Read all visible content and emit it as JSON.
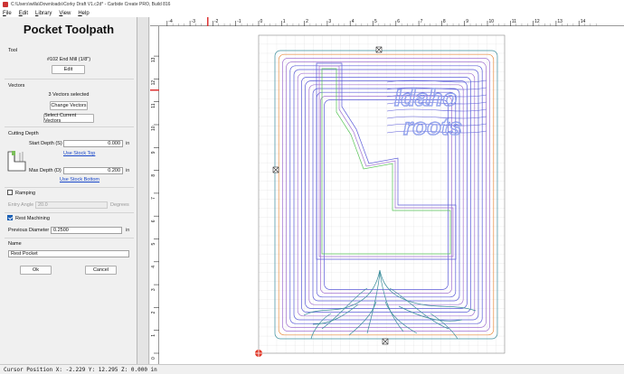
{
  "window": {
    "title": "C:\\Users\\willa\\Downloads\\Corky Draft V1.c2d* - Carbide Create PRO, Build 816"
  },
  "menu": [
    "File",
    "Edit",
    "Library",
    "View",
    "Help"
  ],
  "panel": {
    "title": "Pocket Toolpath",
    "tool": {
      "section": "Tool",
      "name": "#102 End Mill (1/8\")",
      "edit_label": "Edit"
    },
    "vectors": {
      "section": "Vectors",
      "selected_text": "3 Vectors selected",
      "change_label": "Change Vectors",
      "select_current_label": "Select Current Vectors"
    },
    "cutting_depth": {
      "section": "Cutting Depth",
      "start_label": "Start Depth (S)",
      "start_value": "0.000",
      "start_unit": "in",
      "use_stock_top": "Use Stock Top",
      "max_label": "Max Depth (D)",
      "max_value": "0.200",
      "max_unit": "in",
      "use_stock_bottom": "Use Stock Bottom"
    },
    "ramping": {
      "label": "Ramping",
      "checked": false,
      "entry_angle_label": "Entry Angle",
      "entry_angle_value": "20.0",
      "entry_angle_unit": "Degrees"
    },
    "rest_machining": {
      "label": "Rest Machining",
      "checked": true,
      "previous_diameter_label": "Previous Diameter",
      "previous_diameter_value": "0.2500",
      "previous_diameter_unit": "in"
    },
    "name": {
      "section": "Name",
      "value": "Rest Pocket"
    },
    "ok_label": "Ok",
    "cancel_label": "Cancel"
  },
  "canvas": {
    "ruler_x": [
      "-4",
      "-3",
      "-2",
      "-1",
      "0",
      "1",
      "2",
      "3",
      "4",
      "5",
      "6",
      "7",
      "8",
      "9",
      "10",
      "11",
      "12",
      "13",
      "14"
    ],
    "ruler_y": [
      "13",
      "12",
      "11",
      "10",
      "9",
      "8",
      "7",
      "6",
      "5",
      "4",
      "3",
      "2",
      "1",
      "0"
    ],
    "design_text_line1": "Idaho",
    "design_text_line2": "roots",
    "colors": {
      "toolpath_blue": "#5a5ad8",
      "toolpath_purple": "#a070d0",
      "boundary_orange": "#e88a3c",
      "boundary_green": "#56c456",
      "roots_teal": "#3a8c9a"
    }
  },
  "status": {
    "text": "Cursor Position X: -2.229 Y: 12.295 Z: 0.000 in"
  }
}
